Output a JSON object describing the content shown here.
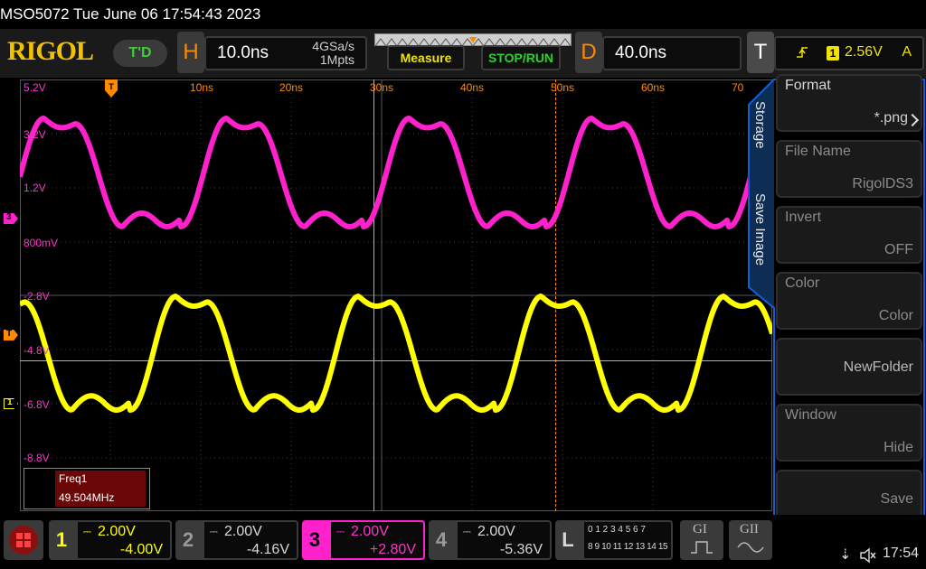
{
  "title_strip": "MSO5072  Tue June 06 17:54:43 2023",
  "header": {
    "logo": "RIGOL",
    "mode_badge": "T'D",
    "horizontal": {
      "key": "H",
      "timebase": "10.0ns",
      "sample_rate": "4GSa/s",
      "memory_depth": "1Mpts"
    },
    "measure_label": "Measure",
    "stop_run_label": "STOP/RUN",
    "delay": {
      "key": "D",
      "value": "40.0ns"
    },
    "trigger": {
      "key": "T",
      "source": "1",
      "level": "2.56V",
      "mode": "A"
    }
  },
  "time_axis": {
    "labels": [
      "10ns",
      "20ns",
      "30ns",
      "40ns",
      "50ns",
      "60ns",
      "70"
    ]
  },
  "channel3_axis": {
    "labels": [
      "5.2V",
      "3.2V",
      "1.2V",
      "800mV"
    ],
    "marker": "3"
  },
  "channel1_axis": {
    "labels": [
      "-2.8V",
      "-4.8V",
      "-6.8V",
      "-8.8V"
    ],
    "marker": "1"
  },
  "trigger_marker": "T",
  "measurement": {
    "name": "Freq1",
    "value": "49.504MHz"
  },
  "side_tabs": {
    "storage": "Storage",
    "save_image": "Save Image"
  },
  "menu": [
    {
      "label": "Format",
      "value": "*.png"
    },
    {
      "label": "File Name",
      "value": "RigolDS3"
    },
    {
      "label": "Invert",
      "value": "OFF"
    },
    {
      "label": "Color",
      "value": "Color"
    },
    {
      "label": "",
      "value": "NewFolder"
    },
    {
      "label": "Window",
      "value": "Hide"
    },
    {
      "label": "",
      "value": "Save"
    }
  ],
  "channels": [
    {
      "num": "1",
      "scale": "2.00V",
      "offset": "-4.00V",
      "color": "#ffff00"
    },
    {
      "num": "2",
      "scale": "2.00V",
      "offset": "-4.16V",
      "color": "#ffffff"
    },
    {
      "num": "3",
      "scale": "2.00V",
      "offset": "+2.80V",
      "color": "#ff33cc"
    },
    {
      "num": "4",
      "scale": "2.00V",
      "offset": "-5.36V",
      "color": "#ffffff"
    }
  ],
  "logic": {
    "key": "L",
    "row1": "0 1 2 3  4 5 6 7",
    "row2": "8 9 10 11 12 13 14 15"
  },
  "gen1": "GI",
  "gen2": "GII",
  "status": {
    "time": "17:54"
  },
  "colors": {
    "ch1": "#ffff00",
    "ch3": "#ff22cc",
    "trigger": "#ff8a00",
    "accent": "#1060d0"
  }
}
